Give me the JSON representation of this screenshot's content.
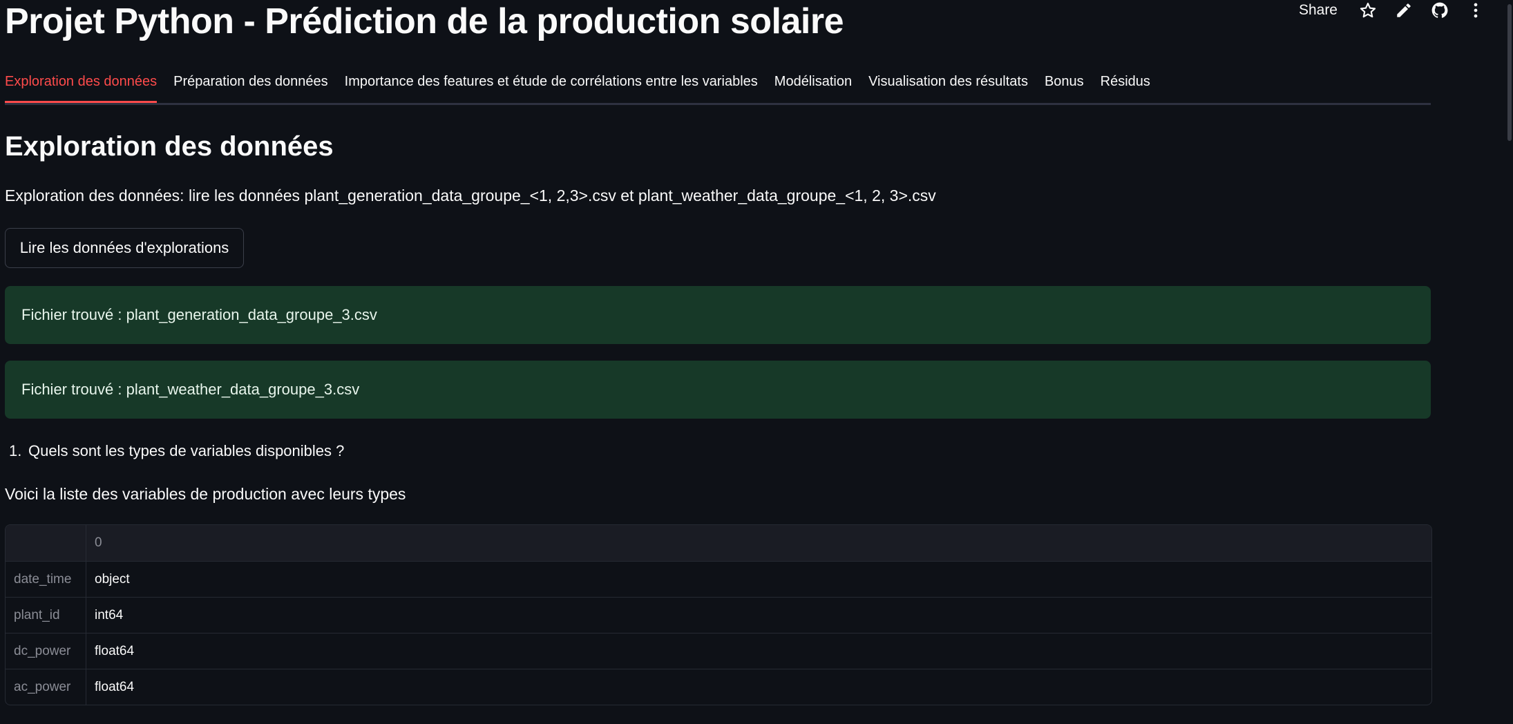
{
  "toolbar": {
    "share_label": "Share",
    "icons": [
      "star-icon",
      "pencil-icon",
      "github-icon",
      "more-vertical-icon"
    ]
  },
  "app": {
    "title": "Projet Python - Prédiction de la production solaire"
  },
  "tabs": [
    {
      "label": "Exploration des données",
      "active": true
    },
    {
      "label": "Préparation des données",
      "active": false
    },
    {
      "label": "Importance des features et étude de corrélations entre les variables",
      "active": false
    },
    {
      "label": "Modélisation",
      "active": false
    },
    {
      "label": "Visualisation des résultats",
      "active": false
    },
    {
      "label": "Bonus",
      "active": false
    },
    {
      "label": "Résidus",
      "active": false
    }
  ],
  "section": {
    "title": "Exploration des données",
    "intro": "Exploration des données: lire les données plant_generation_data_groupe_<1, 2,3>.csv et plant_weather_data_groupe_<1, 2, 3>.csv",
    "button_label": "Lire les données d'explorations",
    "alerts": [
      "Fichier trouvé : plant_generation_data_groupe_3.csv",
      "Fichier trouvé : plant_weather_data_groupe_3.csv"
    ],
    "question_number": "1.",
    "question": "Quels sont les types de variables disponibles ?",
    "table_caption": "Voici la liste des variables de production avec leurs types"
  },
  "dataframe": {
    "column_header": "0",
    "rows": [
      {
        "index": "date_time",
        "value": "object"
      },
      {
        "index": "plant_id",
        "value": "int64"
      },
      {
        "index": "dc_power",
        "value": "float64"
      },
      {
        "index": "ac_power",
        "value": "float64"
      }
    ]
  },
  "colors": {
    "background": "#0e1117",
    "accent": "#ff4b4b",
    "success_bg": "#173928"
  }
}
